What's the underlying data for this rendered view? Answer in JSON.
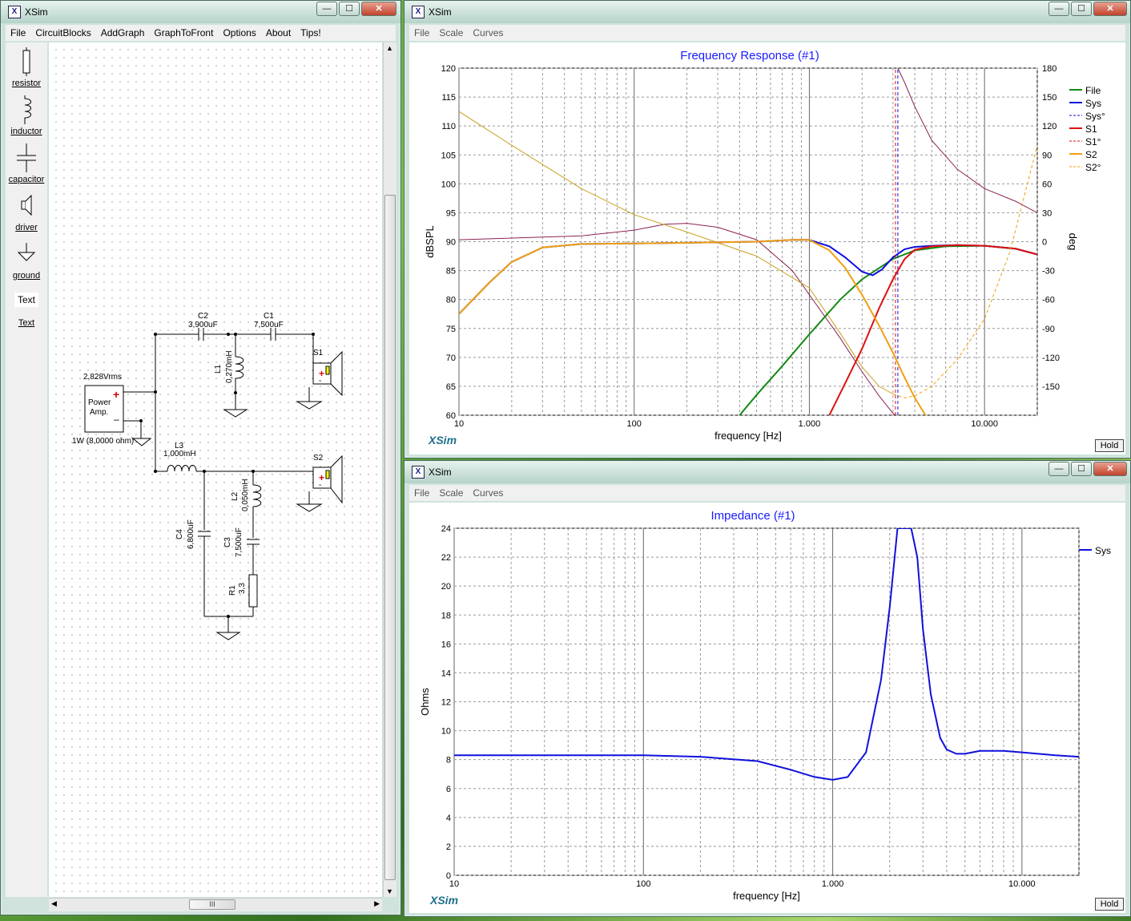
{
  "circuit_window": {
    "title": "XSim",
    "menu": [
      "File",
      "CircuitBlocks",
      "AddGraph",
      "GraphToFront",
      "Options",
      "About",
      "Tips!"
    ],
    "palette": [
      {
        "label": "resistor",
        "icon": "resistor-icon"
      },
      {
        "label": "inductor",
        "icon": "inductor-icon"
      },
      {
        "label": "capacitor",
        "icon": "capacitor-icon"
      },
      {
        "label": "driver",
        "icon": "driver-icon"
      },
      {
        "label": "ground",
        "icon": "ground-icon"
      },
      {
        "label": "Text",
        "icon": "text-icon"
      },
      {
        "label": "Text",
        "icon": "text-link"
      }
    ],
    "schematic": {
      "amp_voltage": "2,828Vrms",
      "amp_label_1": "Power",
      "amp_label_2": "Amp.",
      "amp_power": "1W (8,0000 ohm)",
      "c2_name": "C2",
      "c2_value": "3,900uF",
      "c1_name": "C1",
      "c1_value": "7,500uF",
      "l1_name": "L1",
      "l1_value": "0,270mH",
      "l3_name": "L3",
      "l3_value": "1,000mH",
      "l2_name": "L2",
      "l2_value": "0,050mH",
      "c4_name": "C4",
      "c4_value": "6,800uF",
      "c3_name": "C3",
      "c3_value": "7,500uF",
      "r1_name": "R1",
      "r1_value": "3,3",
      "s1_name": "S1",
      "s2_name": "S2"
    },
    "hscroll_grip": "III"
  },
  "freq_window": {
    "title": "XSim",
    "menu": [
      "File",
      "Scale",
      "Curves"
    ],
    "hold_label": "Hold",
    "brand": "XSim"
  },
  "imp_window": {
    "title": "XSim",
    "menu": [
      "File",
      "Scale",
      "Curves"
    ],
    "hold_label": "Hold",
    "brand": "XSim"
  },
  "chart_data": [
    {
      "type": "line",
      "title": "Frequency Response (#1)",
      "xlabel": "frequency [Hz]",
      "ylabel": "dBSPL",
      "y2label": "deg",
      "xscale": "log",
      "xlim": [
        10,
        20000
      ],
      "ylim": [
        60,
        120
      ],
      "y2lim": [
        -180,
        180
      ],
      "xticks": [
        {
          "v": 10,
          "t": "10"
        },
        {
          "v": 100,
          "t": "100"
        },
        {
          "v": 1000,
          "t": "1.000"
        },
        {
          "v": 10000,
          "t": "10.000"
        }
      ],
      "yticks": [
        60,
        65,
        70,
        75,
        80,
        85,
        90,
        95,
        100,
        105,
        110,
        115,
        120
      ],
      "y2ticks": [
        -150,
        -120,
        -90,
        -60,
        -30,
        0,
        30,
        60,
        90,
        120,
        150,
        180
      ],
      "grid": true,
      "legend_position": "right",
      "series": [
        {
          "name": "File",
          "color": "#138a13",
          "dash": false,
          "axis": "left",
          "x": [
            400,
            500,
            700,
            1000,
            1500,
            2000,
            3000,
            4000,
            6000,
            10000,
            15000,
            20000
          ],
          "y": [
            60,
            63.5,
            68.5,
            74,
            80,
            83.5,
            87,
            88.5,
            89.2,
            89.3,
            88.8,
            87.8
          ]
        },
        {
          "name": "Sys",
          "color": "#1010dd",
          "dash": false,
          "axis": "left",
          "x": [
            10,
            15,
            20,
            30,
            50,
            100,
            200,
            500,
            800,
            1000,
            1300,
            1600,
            2000,
            2300,
            2600,
            3000,
            3500,
            4000,
            5000,
            7000,
            10000,
            15000,
            20000
          ],
          "y": [
            77.5,
            83,
            86.5,
            89,
            89.6,
            89.7,
            89.8,
            90,
            90.3,
            90.3,
            89.2,
            87.3,
            84.8,
            84.2,
            85.2,
            87.3,
            88.7,
            89.1,
            89.3,
            89.4,
            89.3,
            88.8,
            87.8
          ]
        },
        {
          "name": "Sys°",
          "color": "#1010dd",
          "dash": true,
          "axis": "right",
          "x": [
            3200,
            3200
          ],
          "y": [
            -180,
            180
          ]
        },
        {
          "name": "S1",
          "color": "#dd1010",
          "dash": false,
          "axis": "left",
          "x": [
            1300,
            1600,
            2000,
            2500,
            3000,
            3500,
            4000,
            5000,
            7000,
            10000,
            15000,
            20000
          ],
          "y": [
            60,
            65.5,
            71.5,
            78.5,
            83.5,
            87,
            88.6,
            89.2,
            89.4,
            89.3,
            88.8,
            87.8
          ]
        },
        {
          "name": "S1°",
          "color": "#dd1010",
          "dash": true,
          "axis": "right",
          "x": [
            3100,
            3100
          ],
          "y": [
            -180,
            180
          ]
        },
        {
          "name": "S2",
          "color": "#f0a010",
          "dash": false,
          "axis": "left",
          "x": [
            10,
            15,
            20,
            30,
            50,
            100,
            200,
            500,
            800,
            1000,
            1300,
            1600,
            2000,
            2500,
            3000,
            3500,
            4000,
            4600
          ],
          "y": [
            77.5,
            83,
            86.5,
            89,
            89.6,
            89.7,
            89.8,
            90,
            90.3,
            90.3,
            88.5,
            85.5,
            80.8,
            75.5,
            70.8,
            66.5,
            63,
            60
          ]
        },
        {
          "name": "S2°",
          "color": "#f0a010",
          "dash": true,
          "axis": "right",
          "x": [
            3000,
            3500,
            4000,
            5000,
            7000,
            10000,
            14000,
            20000
          ],
          "y": [
            -158,
            -162,
            -160,
            -150,
            -122,
            -80,
            -10,
            100
          ]
        }
      ],
      "phase_traces": [
        {
          "color": "#8b2252",
          "axis": "right",
          "x": [
            10,
            50,
            100,
            150,
            200,
            300,
            500,
            800,
            1000,
            1500,
            2000,
            2500,
            3000,
            3100
          ],
          "y": [
            2,
            6,
            12,
            18,
            19,
            15,
            2,
            -30,
            -55,
            -100,
            -135,
            -160,
            -178,
            -180
          ]
        },
        {
          "color": "#8b2252",
          "axis": "right",
          "x": [
            3200,
            3500,
            4000,
            5000,
            7000,
            10000,
            15000,
            20000
          ],
          "y": [
            180,
            165,
            140,
            105,
            75,
            55,
            42,
            30
          ]
        },
        {
          "color": "#c8a020",
          "axis": "right",
          "x": [
            10,
            20,
            50,
            100,
            200,
            500,
            1000,
            1500,
            2000,
            2500,
            3000
          ],
          "y": [
            135,
            100,
            55,
            28,
            10,
            -15,
            -48,
            -95,
            -130,
            -150,
            -158
          ]
        }
      ]
    },
    {
      "type": "line",
      "title": "Impedance (#1)",
      "xlabel": "frequency [Hz]",
      "ylabel": "Ohms",
      "xscale": "log",
      "xlim": [
        10,
        20000
      ],
      "ylim": [
        0,
        24
      ],
      "xticks": [
        {
          "v": 10,
          "t": "10"
        },
        {
          "v": 100,
          "t": "100"
        },
        {
          "v": 1000,
          "t": "1.000"
        },
        {
          "v": 10000,
          "t": "10.000"
        }
      ],
      "yticks": [
        0,
        2,
        4,
        6,
        8,
        10,
        12,
        14,
        16,
        18,
        20,
        22,
        24
      ],
      "grid": true,
      "legend_position": "right",
      "series": [
        {
          "name": "Sys",
          "color": "#1010dd",
          "dash": false,
          "x": [
            10,
            50,
            100,
            200,
            400,
            600,
            800,
            1000,
            1200,
            1500,
            1800,
            2000,
            2200,
            2600,
            2800,
            3000,
            3300,
            3700,
            4000,
            4500,
            5000,
            6000,
            7000,
            8000,
            10000,
            15000,
            20000
          ],
          "y": [
            8.3,
            8.3,
            8.3,
            8.2,
            7.9,
            7.3,
            6.8,
            6.6,
            6.8,
            8.5,
            13.5,
            18.5,
            24,
            24,
            22,
            17,
            12.5,
            9.5,
            8.7,
            8.4,
            8.4,
            8.6,
            8.6,
            8.6,
            8.5,
            8.3,
            8.2
          ]
        }
      ]
    }
  ]
}
